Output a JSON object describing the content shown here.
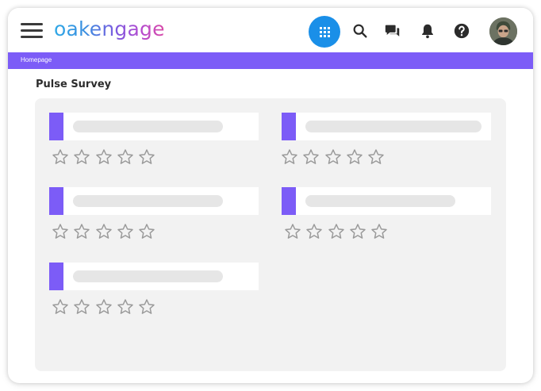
{
  "app": {
    "logo_text": "oakengage",
    "accent_color": "#7c5cf7",
    "apps_button_color": "#1a8fe8"
  },
  "header": {
    "icons": [
      "menu-icon",
      "apps-grid-icon",
      "search-icon",
      "chat-icon",
      "bell-icon",
      "help-icon",
      "avatar"
    ]
  },
  "breadcrumb": {
    "items": [
      "Homepage"
    ]
  },
  "page": {
    "title": "Pulse Survey"
  },
  "survey": {
    "questions": [
      {
        "rating": 0,
        "max_rating": 5
      },
      {
        "rating": 0,
        "max_rating": 5
      },
      {
        "rating": 0,
        "max_rating": 5
      },
      {
        "rating": 0,
        "max_rating": 5
      },
      {
        "rating": 0,
        "max_rating": 5
      }
    ]
  }
}
